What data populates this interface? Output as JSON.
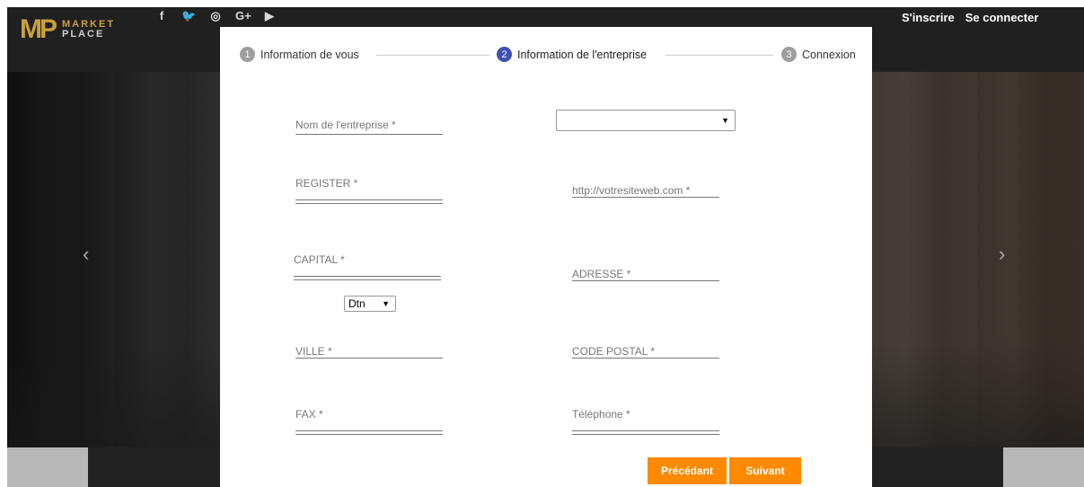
{
  "header": {
    "logo_top": "MARKET",
    "logo_bottom": "PLACE",
    "logo_mark": "MP",
    "social_icons": [
      "facebook-icon",
      "twitter-icon",
      "instagram-icon",
      "google-plus-icon",
      "youtube-icon"
    ],
    "social_glyphs": [
      "f",
      "🐦",
      "◎",
      "G+",
      "▶"
    ],
    "signup_label": "S'inscrire",
    "login_label": "Se connecter"
  },
  "carousel": {
    "prev": "‹",
    "next": "›"
  },
  "stepper": {
    "steps": [
      {
        "num": "1",
        "label": "Information de vous"
      },
      {
        "num": "2",
        "label": "Information de l'entreprise"
      },
      {
        "num": "3",
        "label": "Connexion"
      }
    ],
    "active_step": 2
  },
  "form": {
    "company_name": "Nom de l'entreprise *",
    "company_type_value": "",
    "register": "REGISTER *",
    "website": "http://votresiteweb.com *",
    "capital": "CAPITAL *",
    "currency_value": "Dtn",
    "address": "ADRESSE *",
    "city": "VILLE *",
    "postal_code": "CODE POSTAL *",
    "fax": "FAX *",
    "phone": "Téléphone *"
  },
  "buttons": {
    "previous": "Précédant",
    "next": "Suivant"
  },
  "colors": {
    "accent": "#ff8a00",
    "active_step": "#3f51b5",
    "brand_gold": "#c9a13a"
  }
}
